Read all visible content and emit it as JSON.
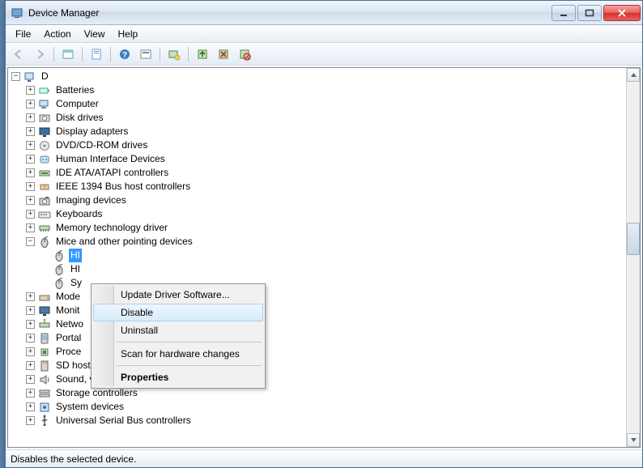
{
  "window": {
    "title": "Device Manager"
  },
  "menubar": [
    "File",
    "Action",
    "View",
    "Help"
  ],
  "toolbar_icons": [
    "back-arrow-icon",
    "forward-arrow-icon",
    "show-hidden-icon",
    "properties-icon",
    "help-icon",
    "refresh-icon",
    "scan-icon",
    "update-driver-icon",
    "uninstall-icon",
    "disable-icon"
  ],
  "tree": {
    "root": "D",
    "nodes": [
      {
        "label": "Batteries",
        "icon": "battery-icon",
        "expanded": false
      },
      {
        "label": "Computer",
        "icon": "computer-icon",
        "expanded": false
      },
      {
        "label": "Disk drives",
        "icon": "disk-icon",
        "expanded": false
      },
      {
        "label": "Display adapters",
        "icon": "display-icon",
        "expanded": false
      },
      {
        "label": "DVD/CD-ROM drives",
        "icon": "optical-icon",
        "expanded": false
      },
      {
        "label": "Human Interface Devices",
        "icon": "hid-icon",
        "expanded": false
      },
      {
        "label": "IDE ATA/ATAPI controllers",
        "icon": "ide-icon",
        "expanded": false
      },
      {
        "label": "IEEE 1394 Bus host controllers",
        "icon": "firewire-icon",
        "expanded": false
      },
      {
        "label": "Imaging devices",
        "icon": "camera-icon",
        "expanded": false
      },
      {
        "label": "Keyboards",
        "icon": "keyboard-icon",
        "expanded": false
      },
      {
        "label": "Memory technology driver",
        "icon": "memory-icon",
        "expanded": false
      },
      {
        "label": "Mice and other pointing devices",
        "icon": "mouse-icon",
        "expanded": true,
        "children": [
          {
            "label": "HI",
            "icon": "mouse-icon",
            "selected": true
          },
          {
            "label": "HI",
            "icon": "mouse-icon"
          },
          {
            "label": "Sy",
            "icon": "mouse-icon"
          }
        ]
      },
      {
        "label": "Mode",
        "icon": "modem-icon",
        "expanded": false,
        "truncated": true
      },
      {
        "label": "Monit",
        "icon": "monitor-icon",
        "expanded": false,
        "truncated": true
      },
      {
        "label": "Netwo",
        "icon": "network-icon",
        "expanded": false,
        "truncated": true
      },
      {
        "label": "Portal",
        "icon": "portable-icon",
        "expanded": false,
        "truncated": true
      },
      {
        "label": "Proce",
        "icon": "processor-icon",
        "expanded": false,
        "truncated": true
      },
      {
        "label": "SD host adapters",
        "icon": "sd-icon",
        "expanded": false
      },
      {
        "label": "Sound, video and game controllers",
        "icon": "sound-icon",
        "expanded": false
      },
      {
        "label": "Storage controllers",
        "icon": "storage-icon",
        "expanded": false
      },
      {
        "label": "System devices",
        "icon": "system-icon",
        "expanded": false
      },
      {
        "label": "Universal Serial Bus controllers",
        "icon": "usb-icon",
        "expanded": false
      }
    ]
  },
  "context_menu": {
    "items": [
      {
        "label": "Update Driver Software...",
        "type": "item"
      },
      {
        "label": "Disable",
        "type": "item",
        "highlighted": true
      },
      {
        "label": "Uninstall",
        "type": "item"
      },
      {
        "type": "separator"
      },
      {
        "label": "Scan for hardware changes",
        "type": "item"
      },
      {
        "type": "separator"
      },
      {
        "label": "Properties",
        "type": "item",
        "bold": true
      }
    ]
  },
  "statusbar": {
    "text": "Disables the selected device."
  }
}
